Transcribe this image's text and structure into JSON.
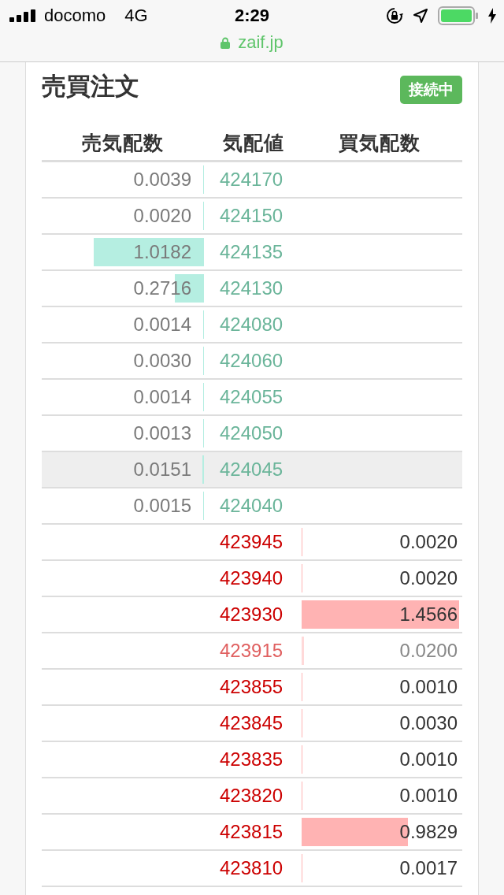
{
  "status_bar": {
    "carrier": "docomo",
    "network": "4G",
    "time": "2:29"
  },
  "address_bar": {
    "url": "zaif.jp"
  },
  "panel": {
    "title": "売買注文",
    "status_badge": "接続中"
  },
  "table": {
    "columns": [
      "売気配数",
      "気配値",
      "買気配数"
    ],
    "rows": [
      {
        "kind": "ask",
        "price": "424170",
        "quantity": "0.0039",
        "highlighted": false,
        "dimmed": false
      },
      {
        "kind": "ask",
        "price": "424150",
        "quantity": "0.0020",
        "highlighted": false,
        "dimmed": false
      },
      {
        "kind": "ask",
        "price": "424135",
        "quantity": "1.0182",
        "highlighted": false,
        "dimmed": false
      },
      {
        "kind": "ask",
        "price": "424130",
        "quantity": "0.2716",
        "highlighted": false,
        "dimmed": false
      },
      {
        "kind": "ask",
        "price": "424080",
        "quantity": "0.0014",
        "highlighted": false,
        "dimmed": false
      },
      {
        "kind": "ask",
        "price": "424060",
        "quantity": "0.0030",
        "highlighted": false,
        "dimmed": false
      },
      {
        "kind": "ask",
        "price": "424055",
        "quantity": "0.0014",
        "highlighted": false,
        "dimmed": false
      },
      {
        "kind": "ask",
        "price": "424050",
        "quantity": "0.0013",
        "highlighted": false,
        "dimmed": false
      },
      {
        "kind": "ask",
        "price": "424045",
        "quantity": "0.0151",
        "highlighted": true,
        "dimmed": false
      },
      {
        "kind": "ask",
        "price": "424040",
        "quantity": "0.0015",
        "highlighted": false,
        "dimmed": false
      },
      {
        "kind": "bid",
        "price": "423945",
        "quantity": "0.0020",
        "highlighted": false,
        "dimmed": false
      },
      {
        "kind": "bid",
        "price": "423940",
        "quantity": "0.0020",
        "highlighted": false,
        "dimmed": false
      },
      {
        "kind": "bid",
        "price": "423930",
        "quantity": "1.4566",
        "highlighted": false,
        "dimmed": false
      },
      {
        "kind": "bid",
        "price": "423915",
        "quantity": "0.0200",
        "highlighted": false,
        "dimmed": true
      },
      {
        "kind": "bid",
        "price": "423855",
        "quantity": "0.0010",
        "highlighted": false,
        "dimmed": false
      },
      {
        "kind": "bid",
        "price": "423845",
        "quantity": "0.0030",
        "highlighted": false,
        "dimmed": false
      },
      {
        "kind": "bid",
        "price": "423835",
        "quantity": "0.0010",
        "highlighted": false,
        "dimmed": false
      },
      {
        "kind": "bid",
        "price": "423820",
        "quantity": "0.0010",
        "highlighted": false,
        "dimmed": false
      },
      {
        "kind": "bid",
        "price": "423815",
        "quantity": "0.9829",
        "highlighted": false,
        "dimmed": false
      },
      {
        "kind": "bid",
        "price": "423810",
        "quantity": "0.0017",
        "highlighted": false,
        "dimmed": false
      }
    ]
  }
}
